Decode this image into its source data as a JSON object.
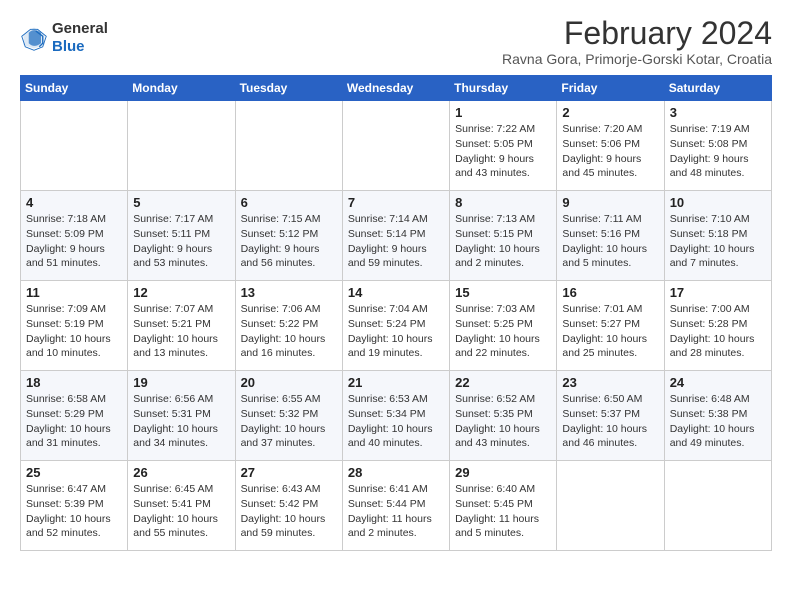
{
  "header": {
    "logo": {
      "general": "General",
      "blue": "Blue"
    },
    "title": "February 2024",
    "subtitle": "Ravna Gora, Primorje-Gorski Kotar, Croatia"
  },
  "calendar": {
    "headers": [
      "Sunday",
      "Monday",
      "Tuesday",
      "Wednesday",
      "Thursday",
      "Friday",
      "Saturday"
    ],
    "weeks": [
      [
        {
          "day": "",
          "info": ""
        },
        {
          "day": "",
          "info": ""
        },
        {
          "day": "",
          "info": ""
        },
        {
          "day": "",
          "info": ""
        },
        {
          "day": "1",
          "info": "Sunrise: 7:22 AM\nSunset: 5:05 PM\nDaylight: 9 hours and 43 minutes."
        },
        {
          "day": "2",
          "info": "Sunrise: 7:20 AM\nSunset: 5:06 PM\nDaylight: 9 hours and 45 minutes."
        },
        {
          "day": "3",
          "info": "Sunrise: 7:19 AM\nSunset: 5:08 PM\nDaylight: 9 hours and 48 minutes."
        }
      ],
      [
        {
          "day": "4",
          "info": "Sunrise: 7:18 AM\nSunset: 5:09 PM\nDaylight: 9 hours and 51 minutes."
        },
        {
          "day": "5",
          "info": "Sunrise: 7:17 AM\nSunset: 5:11 PM\nDaylight: 9 hours and 53 minutes."
        },
        {
          "day": "6",
          "info": "Sunrise: 7:15 AM\nSunset: 5:12 PM\nDaylight: 9 hours and 56 minutes."
        },
        {
          "day": "7",
          "info": "Sunrise: 7:14 AM\nSunset: 5:14 PM\nDaylight: 9 hours and 59 minutes."
        },
        {
          "day": "8",
          "info": "Sunrise: 7:13 AM\nSunset: 5:15 PM\nDaylight: 10 hours and 2 minutes."
        },
        {
          "day": "9",
          "info": "Sunrise: 7:11 AM\nSunset: 5:16 PM\nDaylight: 10 hours and 5 minutes."
        },
        {
          "day": "10",
          "info": "Sunrise: 7:10 AM\nSunset: 5:18 PM\nDaylight: 10 hours and 7 minutes."
        }
      ],
      [
        {
          "day": "11",
          "info": "Sunrise: 7:09 AM\nSunset: 5:19 PM\nDaylight: 10 hours and 10 minutes."
        },
        {
          "day": "12",
          "info": "Sunrise: 7:07 AM\nSunset: 5:21 PM\nDaylight: 10 hours and 13 minutes."
        },
        {
          "day": "13",
          "info": "Sunrise: 7:06 AM\nSunset: 5:22 PM\nDaylight: 10 hours and 16 minutes."
        },
        {
          "day": "14",
          "info": "Sunrise: 7:04 AM\nSunset: 5:24 PM\nDaylight: 10 hours and 19 minutes."
        },
        {
          "day": "15",
          "info": "Sunrise: 7:03 AM\nSunset: 5:25 PM\nDaylight: 10 hours and 22 minutes."
        },
        {
          "day": "16",
          "info": "Sunrise: 7:01 AM\nSunset: 5:27 PM\nDaylight: 10 hours and 25 minutes."
        },
        {
          "day": "17",
          "info": "Sunrise: 7:00 AM\nSunset: 5:28 PM\nDaylight: 10 hours and 28 minutes."
        }
      ],
      [
        {
          "day": "18",
          "info": "Sunrise: 6:58 AM\nSunset: 5:29 PM\nDaylight: 10 hours and 31 minutes."
        },
        {
          "day": "19",
          "info": "Sunrise: 6:56 AM\nSunset: 5:31 PM\nDaylight: 10 hours and 34 minutes."
        },
        {
          "day": "20",
          "info": "Sunrise: 6:55 AM\nSunset: 5:32 PM\nDaylight: 10 hours and 37 minutes."
        },
        {
          "day": "21",
          "info": "Sunrise: 6:53 AM\nSunset: 5:34 PM\nDaylight: 10 hours and 40 minutes."
        },
        {
          "day": "22",
          "info": "Sunrise: 6:52 AM\nSunset: 5:35 PM\nDaylight: 10 hours and 43 minutes."
        },
        {
          "day": "23",
          "info": "Sunrise: 6:50 AM\nSunset: 5:37 PM\nDaylight: 10 hours and 46 minutes."
        },
        {
          "day": "24",
          "info": "Sunrise: 6:48 AM\nSunset: 5:38 PM\nDaylight: 10 hours and 49 minutes."
        }
      ],
      [
        {
          "day": "25",
          "info": "Sunrise: 6:47 AM\nSunset: 5:39 PM\nDaylight: 10 hours and 52 minutes."
        },
        {
          "day": "26",
          "info": "Sunrise: 6:45 AM\nSunset: 5:41 PM\nDaylight: 10 hours and 55 minutes."
        },
        {
          "day": "27",
          "info": "Sunrise: 6:43 AM\nSunset: 5:42 PM\nDaylight: 10 hours and 59 minutes."
        },
        {
          "day": "28",
          "info": "Sunrise: 6:41 AM\nSunset: 5:44 PM\nDaylight: 11 hours and 2 minutes."
        },
        {
          "day": "29",
          "info": "Sunrise: 6:40 AM\nSunset: 5:45 PM\nDaylight: 11 hours and 5 minutes."
        },
        {
          "day": "",
          "info": ""
        },
        {
          "day": "",
          "info": ""
        }
      ]
    ]
  }
}
